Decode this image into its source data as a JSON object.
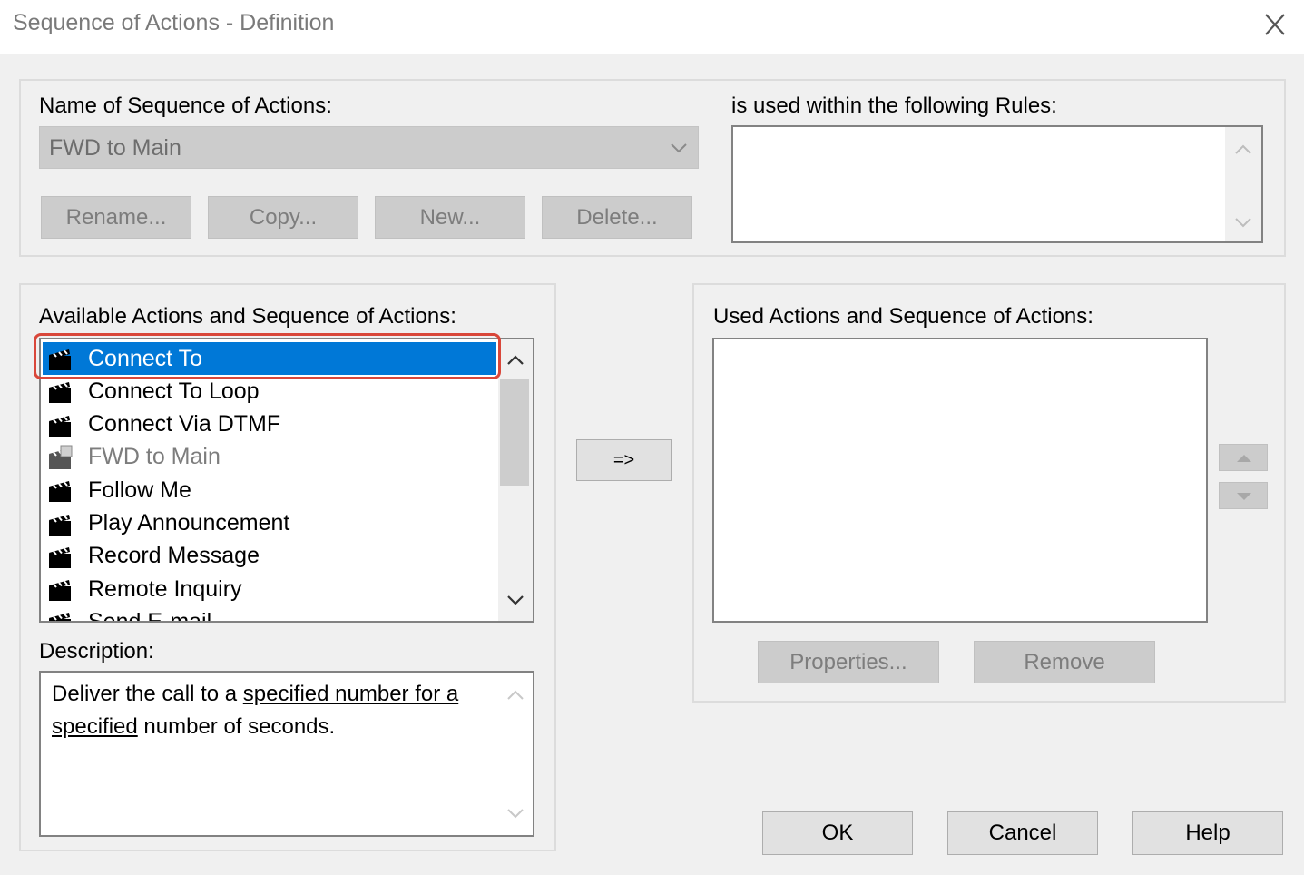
{
  "window": {
    "title": "Sequence of Actions - Definition",
    "close_icon": "close-icon"
  },
  "name_section": {
    "label": "Name of Sequence of Actions:",
    "selected_value": "FWD to Main",
    "buttons": {
      "rename": "Rename...",
      "copy": "Copy...",
      "new": "New...",
      "delete": "Delete..."
    }
  },
  "rules_section": {
    "label": "is used within the following Rules:",
    "items": []
  },
  "available_section": {
    "label": "Available Actions and Sequence of Actions:",
    "items": [
      {
        "label": "Connect To",
        "icon": "clapperboard-icon",
        "selected": true
      },
      {
        "label": "Connect To Loop",
        "icon": "clapperboard-icon"
      },
      {
        "label": "Connect Via DTMF",
        "icon": "clapperboard-icon"
      },
      {
        "label": "FWD to Main",
        "icon": "sequence-icon",
        "disabled": true
      },
      {
        "label": "Follow Me",
        "icon": "clapperboard-icon"
      },
      {
        "label": "Play Announcement",
        "icon": "clapperboard-icon"
      },
      {
        "label": "Record Message",
        "icon": "clapperboard-icon"
      },
      {
        "label": "Remote Inquiry",
        "icon": "clapperboard-icon"
      },
      {
        "label": "Send E-mail",
        "icon": "clapperboard-icon"
      }
    ],
    "description_label": "Description:",
    "description": {
      "part1": "Deliver the call to a ",
      "link1": "specified number for a",
      "link2": "specified",
      "part2": " number of seconds."
    }
  },
  "add_button": "=>",
  "used_section": {
    "label": "Used Actions and Sequence of Actions:",
    "items": [],
    "properties_button": "Properties...",
    "remove_button": "Remove"
  },
  "footer": {
    "ok": "OK",
    "cancel": "Cancel",
    "help": "Help"
  },
  "colors": {
    "selection": "#0078d7",
    "highlight_ring": "#d9473a"
  }
}
